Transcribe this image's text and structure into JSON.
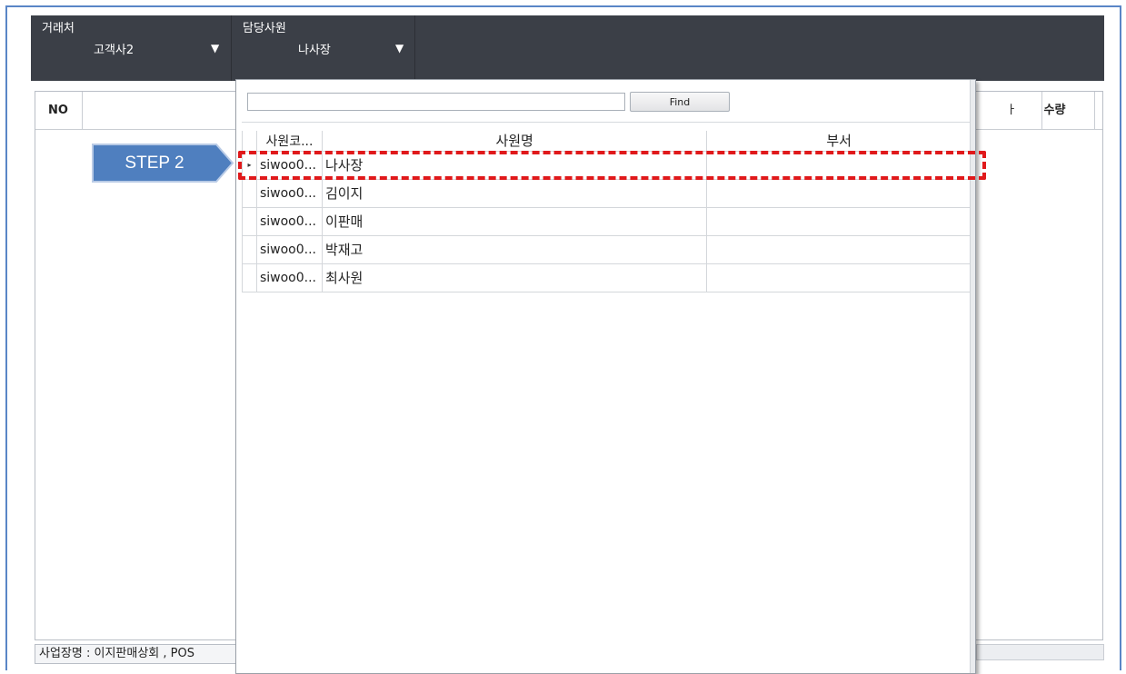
{
  "header": {
    "customer": {
      "label": "거래처",
      "value": "고객사2",
      "arrow": "▼"
    },
    "employee": {
      "label": "담당사원",
      "value": "나사장",
      "arrow": "▼"
    }
  },
  "grid": {
    "col_no": "NO",
    "col_partial": "ㅏ",
    "col_qty": "수량"
  },
  "status": {
    "text": "사업장명 : 이지판매상회 , POS"
  },
  "popup": {
    "search_value": "",
    "find_label": "Find",
    "columns": {
      "code": "사원코...",
      "name": "사원명",
      "dept": "부서"
    },
    "rows": [
      {
        "marker": "▸",
        "code": "siwoo0...",
        "name": "나사장",
        "dept": ""
      },
      {
        "marker": "",
        "code": "siwoo0...",
        "name": "김이지",
        "dept": ""
      },
      {
        "marker": "",
        "code": "siwoo0...",
        "name": "이판매",
        "dept": ""
      },
      {
        "marker": "",
        "code": "siwoo0...",
        "name": "박재고",
        "dept": ""
      },
      {
        "marker": "",
        "code": "siwoo0...",
        "name": "최사원",
        "dept": ""
      }
    ]
  },
  "annotation": {
    "step_label": "STEP 2",
    "step_color": "#4f7fbf",
    "highlight_color": "#e0191b"
  },
  "colors": {
    "header_bg": "#3b3f47",
    "frame_border": "#5a86c6"
  }
}
